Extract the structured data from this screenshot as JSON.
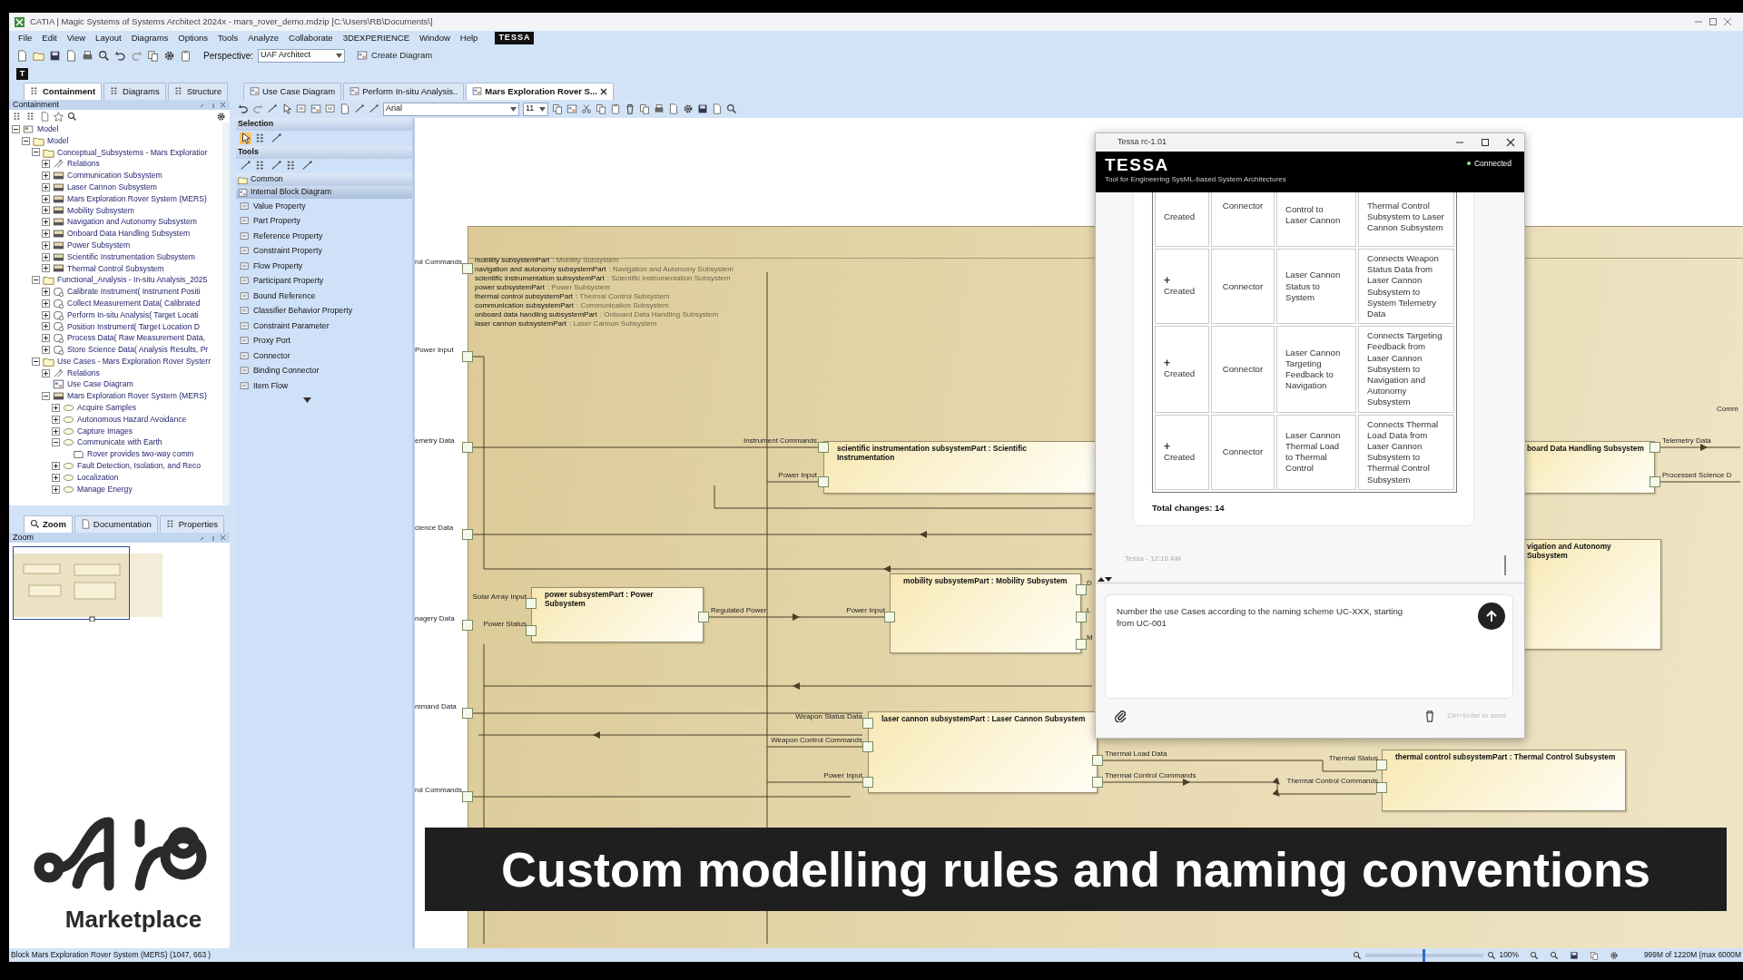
{
  "window": {
    "title": "CATIA | Magic Systems of Systems Architect 2024x - mars_rover_demo.mdzip [C:\\Users\\RB\\Documents\\]"
  },
  "menu": [
    "File",
    "Edit",
    "View",
    "Layout",
    "Diagrams",
    "Options",
    "Tools",
    "Analyze",
    "Collaborate",
    "3DEXPERIENCE",
    "Window",
    "Help"
  ],
  "menu_logo": "TESSA",
  "toolbar": {
    "perspective_label": "Perspective:",
    "perspective": "UAF Architect",
    "create_diagram": "Create Diagram"
  },
  "side_toolbar_button": "T",
  "browser_tabs": [
    {
      "label": "Containment",
      "selected": true
    },
    {
      "label": "Diagrams",
      "selected": false
    },
    {
      "label": "Structure",
      "selected": false
    }
  ],
  "containment": {
    "title": "Containment",
    "tree": [
      {
        "label": "Model",
        "kind": "model",
        "expanded": true,
        "children": [
          {
            "label": "Model",
            "kind": "folder",
            "expanded": true,
            "children": [
              {
                "label": "Conceptual_Subsystems - Mars Exploratior",
                "kind": "folder",
                "expanded": true,
                "children": [
                  {
                    "label": "Relations",
                    "kind": "relations",
                    "expanded": false
                  },
                  {
                    "label": "Communication Subsystem",
                    "kind": "block",
                    "expanded": false
                  },
                  {
                    "label": "Laser Cannon Subsystem",
                    "kind": "block",
                    "expanded": false
                  },
                  {
                    "label": "Mars Exploration Rover System (MERS)",
                    "kind": "block",
                    "expanded": false
                  },
                  {
                    "label": "Mobility Subsystem",
                    "kind": "block",
                    "expanded": false
                  },
                  {
                    "label": "Navigation and Autonomy Subsystem",
                    "kind": "block",
                    "expanded": false
                  },
                  {
                    "label": "Onboard Data Handling Subsystem",
                    "kind": "block",
                    "expanded": false
                  },
                  {
                    "label": "Power Subsystem",
                    "kind": "block",
                    "expanded": false
                  },
                  {
                    "label": "Scientific Instrumentation Subsystem",
                    "kind": "block",
                    "expanded": false
                  },
                  {
                    "label": "Thermal Control Subsystem",
                    "kind": "block",
                    "expanded": false
                  }
                ]
              },
              {
                "label": "Functional_Analysis - In-situ Analysis_2025",
                "kind": "folder",
                "expanded": true,
                "children": [
                  {
                    "label": "Calibrate Instrument( Instrument Positi",
                    "kind": "activity",
                    "expanded": false
                  },
                  {
                    "label": "Collect Measurement Data( Calibrated",
                    "kind": "activity",
                    "expanded": false
                  },
                  {
                    "label": "Perform In-situ Analysis( Target Locati",
                    "kind": "activity",
                    "expanded": false
                  },
                  {
                    "label": "Position Instrument( Target Location D",
                    "kind": "activity",
                    "expanded": false
                  },
                  {
                    "label": "Process Data( Raw Measurement Data,",
                    "kind": "activity",
                    "expanded": false
                  },
                  {
                    "label": "Store Science Data( Analysis Results, Pr",
                    "kind": "activity",
                    "expanded": false
                  }
                ]
              },
              {
                "label": "Use Cases - Mars Exploration Rover Systerr",
                "kind": "folder",
                "expanded": true,
                "children": [
                  {
                    "label": "Relations",
                    "kind": "relations",
                    "expanded": false
                  },
                  {
                    "label": "Use Case Diagram",
                    "kind": "diagram"
                  },
                  {
                    "label": "Mars Exploration Rover System (MERS)",
                    "kind": "block",
                    "expanded": true,
                    "children": [
                      {
                        "label": "Acquire Samples",
                        "kind": "usecase",
                        "expanded": false
                      },
                      {
                        "label": "Autonomous Hazard Avoidance",
                        "kind": "usecase",
                        "expanded": false
                      },
                      {
                        "label": "Capture Images",
                        "kind": "usecase",
                        "expanded": false
                      },
                      {
                        "label": "Communicate with Earth",
                        "kind": "usecase",
                        "expanded": true,
                        "children": [
                          {
                            "label": "Rover provides two-way comm",
                            "kind": "note"
                          }
                        ]
                      },
                      {
                        "label": "Fault Detection, Isolation, and Reco",
                        "kind": "usecase",
                        "expanded": false
                      },
                      {
                        "label": "Localization",
                        "kind": "usecase",
                        "expanded": false
                      },
                      {
                        "label": "Manage Energy",
                        "kind": "usecase",
                        "expanded": false
                      }
                    ]
                  }
                ]
              }
            ]
          }
        ]
      }
    ]
  },
  "lower_tabs": [
    {
      "label": "Zoom",
      "selected": true
    },
    {
      "label": "Documentation",
      "selected": false
    },
    {
      "label": "Properties",
      "selected": false
    }
  ],
  "zoom_panel": {
    "title": "Zoom"
  },
  "diagram_tabs": [
    {
      "label": "Use Case Diagram",
      "selected": false
    },
    {
      "label": "Perform In-situ Analysis..",
      "selected": false
    },
    {
      "label": "Mars Exploration Rover S...",
      "selected": true,
      "closable": true
    }
  ],
  "diagram_toolbar": {
    "font": "Arial",
    "size": "11"
  },
  "palette": [
    {
      "kind": "header",
      "label": "Selection"
    },
    {
      "kind": "tools",
      "tools": [
        {
          "selected": true
        },
        {
          "selected": false
        },
        {
          "selected": false
        }
      ]
    },
    {
      "kind": "header",
      "label": "Tools"
    },
    {
      "kind": "tools",
      "tools": [
        {
          "selected": false
        },
        {
          "selected": false
        },
        {
          "selected": false
        },
        {
          "selected": false
        },
        {
          "selected": false
        }
      ]
    },
    {
      "kind": "folder",
      "label": "Common"
    },
    {
      "kind": "group",
      "label": "Internal Block Diagram"
    },
    {
      "kind": "item",
      "label": "Value Property"
    },
    {
      "kind": "item",
      "label": "Part Property"
    },
    {
      "kind": "item",
      "label": "Reference Property"
    },
    {
      "kind": "item",
      "label": "Constraint Property"
    },
    {
      "kind": "item",
      "label": "Flow Property"
    },
    {
      "kind": "item",
      "label": "Participant Property"
    },
    {
      "kind": "item",
      "label": "Bound Reference"
    },
    {
      "kind": "item",
      "label": "Classifier Behavior Property"
    },
    {
      "kind": "item",
      "label": "Constraint Parameter"
    },
    {
      "kind": "item",
      "label": "Proxy Port"
    },
    {
      "kind": "item",
      "label": "Connector"
    },
    {
      "kind": "item",
      "label": "Binding Connector"
    },
    {
      "kind": "item",
      "label": "Item Flow"
    }
  ],
  "diagram": {
    "parts_list": [
      {
        "part": "mobility subsystemPart",
        "type": ": Mobility Subsystem"
      },
      {
        "part": "navigation and autonomy subsystemPart",
        "type": ": Navigation and Autonomy Subsystem"
      },
      {
        "part": "scientific instrumentation subsystemPart",
        "type": ": Scientific Instrumentation Subsystem"
      },
      {
        "part": "power subsystemPart",
        "type": ": Power Subsystem"
      },
      {
        "part": "thermal control subsystemPart",
        "type": ": Thermal Control Subsystem"
      },
      {
        "part": "communication subsystemPart",
        "type": ": Communication Subsystem"
      },
      {
        "part": "onboard data handling subsystemPart",
        "type": ": Onboard Data Handling Subsystem"
      },
      {
        "part": "laser cannon subsystemPart",
        "type": ": Laser Cannon Subsystem"
      }
    ],
    "frame_ports": [
      "rol Commands",
      "Power Input",
      "emetry Data",
      "cience Data",
      "nagery Data",
      "mmand Data",
      "rol Commands",
      "Comm"
    ],
    "blocks": [
      {
        "title": "scientific instrumentation subsystemPart : Scientific Instrumentation",
        "ports": [
          "Instrument Commands",
          "Power Input"
        ]
      },
      {
        "title": "board Data Handling Subsystem",
        "ports": [
          "Telemetry Data",
          "Processed Science D"
        ]
      },
      {
        "title": "vigation and Autonomy Subsystem"
      },
      {
        "title": "power subsystemPart : Power Subsystem",
        "ports": [
          "Solar Array Input",
          "Power Status",
          "Regulated Power"
        ]
      },
      {
        "title": "mobility subsystemPart : Mobility Subsystem",
        "ports": [
          "Power Input",
          "D",
          "L",
          "M"
        ]
      },
      {
        "title": "laser cannon subsystemPart : Laser Cannon Subsystem",
        "ports": [
          "Weapon Status Data",
          "Weapon Control Commands",
          "Power Input",
          "Thermal Load Data",
          "Thermal Control Commands"
        ]
      },
      {
        "title": "thermal control subsystemPart : Thermal Control Subsystem",
        "ports": [
          "Thermal Status",
          "Thermal Control Commands"
        ]
      }
    ]
  },
  "tessa": {
    "title": "Tessa rc-1.01",
    "brand": "TESSA",
    "subtitle": "Tool for Engineering SysML-based System Architectures",
    "status": {
      "label": "Connected",
      "connected": true
    },
    "changes": [
      {
        "action": "Created",
        "type": "Connector",
        "name": "Control to Laser Cannon",
        "description": "Thermal Control Subsystem to Laser Cannon Subsystem"
      },
      {
        "sign": "+",
        "action": "Created",
        "type": "Connector",
        "name": "Laser Cannon Status to System",
        "description": "Connects Weapon Status Data from Laser Cannon Subsystem to System Telemetry Data"
      },
      {
        "sign": "+",
        "action": "Created",
        "type": "Connector",
        "name": "Laser Cannon Targeting Feedback to Navigation",
        "description": "Connects Targeting Feedback from Laser Cannon Subsystem to Navigation and Autonomy Subsystem"
      },
      {
        "sign": "+",
        "action": "Created",
        "type": "Connector",
        "name": "Laser Cannon Thermal Load to Thermal Control",
        "description": "Connects Thermal Load Data from Laser Cannon Subsystem to Thermal Control Subsystem"
      }
    ],
    "total": "Total changes: 14",
    "meta": "Tessa - 12:16 AM",
    "message": "Number the use Cases according to the naming scheme UC-XXX, starting from UC-001",
    "hint": "Ctrl+Enter to send"
  },
  "caption": "Custom modelling rules and naming conventions",
  "logo": {
    "text": "Marketplace"
  },
  "status_bar": {
    "text": "Block Mars Exploration Rover System (MERS) (1047, 663 )",
    "zoom_slider": {
      "level": 0.49
    },
    "zoom": "100%",
    "memory": "999M of 1220M (max 6000M"
  }
}
